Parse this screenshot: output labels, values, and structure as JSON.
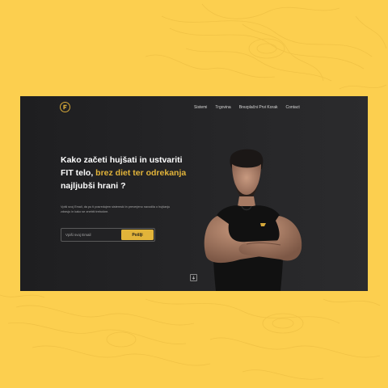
{
  "nav": {
    "items": [
      "Sistemi",
      "Trgovina",
      "Brezplačni Prvi Korak",
      "Contact"
    ]
  },
  "hero": {
    "headline_part1": "Kako začeti hujšati in ustvariti FIT telo, ",
    "headline_highlight": "brez diet ter odrekanja",
    "headline_part2": " najljubši hrani ?",
    "subtext": "Vpiši svoj Email, da pu ti posredujem sistemski in preverjeno navodila o hujšanju zdravju in kako se znebiti trebušne."
  },
  "form": {
    "email_placeholder": "Vpiši svoj Email",
    "submit_label": "Pošlji"
  },
  "colors": {
    "background": "#fccf4f",
    "card": "#232325",
    "accent": "#e2b43a"
  },
  "icons": {
    "logo": "fit-logo-icon",
    "scroll": "arrow-down-icon"
  }
}
